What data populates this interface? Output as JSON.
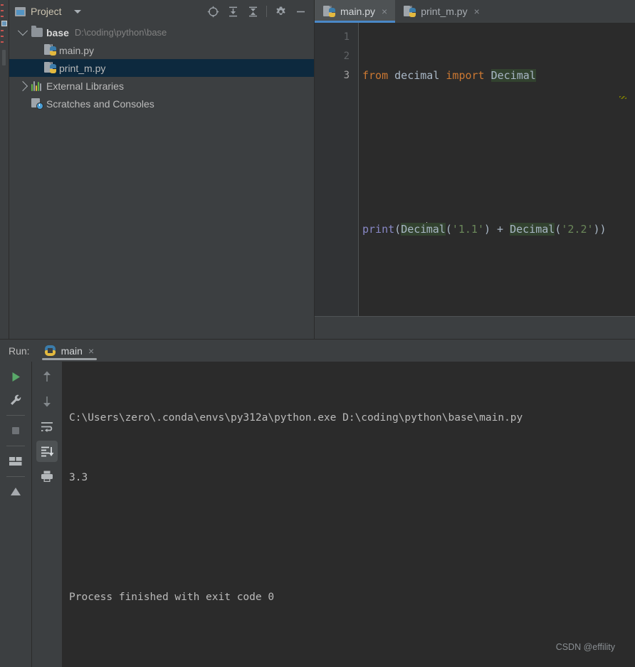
{
  "project_panel": {
    "title": "Project",
    "window_icon": "project-window-icon",
    "dropdown_icon": "chevron-down-icon",
    "toolbar": [
      {
        "name": "select-opened-file-icon",
        "label": "Select Opened File"
      },
      {
        "name": "expand-all-icon",
        "label": "Expand All"
      },
      {
        "name": "collapse-all-icon",
        "label": "Collapse All"
      },
      {
        "name": "settings-gear-icon",
        "label": "Options"
      },
      {
        "name": "hide-icon",
        "label": "Hide"
      }
    ],
    "tree": [
      {
        "name": "base",
        "path": "D:\\coding\\python\\base",
        "icon": "folder-icon",
        "expanded": true,
        "selected": false,
        "depth": 0
      },
      {
        "name": "main.py",
        "path": "",
        "icon": "python-file-icon",
        "expanded": null,
        "selected": false,
        "depth": 1
      },
      {
        "name": "print_m.py",
        "path": "",
        "icon": "python-file-icon",
        "expanded": null,
        "selected": true,
        "depth": 1
      },
      {
        "name": "External Libraries",
        "path": "",
        "icon": "external-libraries-icon",
        "expanded": false,
        "selected": false,
        "depth": 0
      },
      {
        "name": "Scratches and Consoles",
        "path": "",
        "icon": "scratches-icon",
        "expanded": null,
        "selected": false,
        "depth": 0
      }
    ]
  },
  "editor": {
    "tabs": [
      {
        "label": "main.py",
        "icon": "python-file-icon",
        "active": true,
        "close_icon": "×"
      },
      {
        "label": "print_m.py",
        "icon": "python-file-icon",
        "active": false,
        "close_icon": "×"
      }
    ],
    "line_numbers": [
      "1",
      "2",
      "3"
    ],
    "current_line": 3,
    "lines": [
      {
        "number": "1",
        "tokens": [
          {
            "text": "from",
            "type": "kw"
          },
          {
            "text": " ",
            "type": "plain"
          },
          {
            "text": "decimal",
            "type": "ident"
          },
          {
            "text": " ",
            "type": "plain"
          },
          {
            "text": "import",
            "type": "kw"
          },
          {
            "text": " ",
            "type": "plain"
          },
          {
            "text": "Decimal",
            "type": "ident",
            "highlight": true
          }
        ]
      },
      {
        "number": "2",
        "tokens": []
      },
      {
        "number": "3",
        "tokens": [
          {
            "text": "print",
            "type": "func"
          },
          {
            "text": "(",
            "type": "punc"
          },
          {
            "text": "Deci",
            "type": "ident",
            "highlight": true
          },
          {
            "text": "caret",
            "type": "caret"
          },
          {
            "text": "mal",
            "type": "ident",
            "highlight": true
          },
          {
            "text": "(",
            "type": "punc"
          },
          {
            "text": "'1.1'",
            "type": "str"
          },
          {
            "text": ")",
            "type": "punc"
          },
          {
            "text": " + ",
            "type": "punc"
          },
          {
            "text": "Decimal",
            "type": "ident",
            "highlight": true
          },
          {
            "text": "(",
            "type": "punc"
          },
          {
            "text": "'2.2'",
            "type": "str"
          },
          {
            "text": "))",
            "type": "punc"
          }
        ]
      }
    ],
    "code_text_line1": "from decimal import Decimal",
    "code_text_line3": "print(Decimal('1.1') + Decimal('2.2'))"
  },
  "run_panel": {
    "label": "Run:",
    "tab": {
      "label": "main",
      "icon": "python-icon",
      "close_icon": "×"
    },
    "toolbar_left": [
      {
        "name": "run-button",
        "label": "Rerun"
      },
      {
        "name": "settings-wrench-icon",
        "label": "Modify Run Configuration"
      },
      {
        "name": "stop-button",
        "label": "Stop"
      },
      {
        "name": "layout-settings-icon",
        "label": "Layout Settings"
      },
      {
        "name": "pin-tab-icon",
        "label": "Pin Tab"
      }
    ],
    "toolbar_right": [
      {
        "name": "up-arrow-icon",
        "label": "Up the Stack Trace"
      },
      {
        "name": "down-arrow-icon",
        "label": "Down the Stack Trace"
      },
      {
        "name": "soft-wrap-icon",
        "label": "Use Soft Wraps"
      },
      {
        "name": "scroll-to-end-icon",
        "label": "Scroll to End",
        "active": true
      },
      {
        "name": "print-icon",
        "label": "Print"
      }
    ],
    "console": [
      "C:\\Users\\zero\\.conda\\envs\\py312a\\python.exe D:\\coding\\python\\base\\main.py",
      "3.3",
      "",
      "Process finished with exit code 0"
    ],
    "console_line_1": "C:\\Users\\zero\\.conda\\envs\\py312a\\python.exe D:\\coding\\python\\base\\main.py",
    "console_line_2": "3.3",
    "console_line_3": "Process finished with exit code 0"
  },
  "watermark": "CSDN @effility",
  "colors": {
    "background": "#3c3f41",
    "editor_background": "#2b2b2b",
    "selection": "#0d293e",
    "accent_blue": "#4a88c7",
    "keyword_orange": "#cc7832",
    "string_green": "#6a8759",
    "function_violet": "#8888c6",
    "identifier": "#a9b7c6",
    "occurrence_highlight": "#32422f",
    "run_green": "#59a869"
  }
}
